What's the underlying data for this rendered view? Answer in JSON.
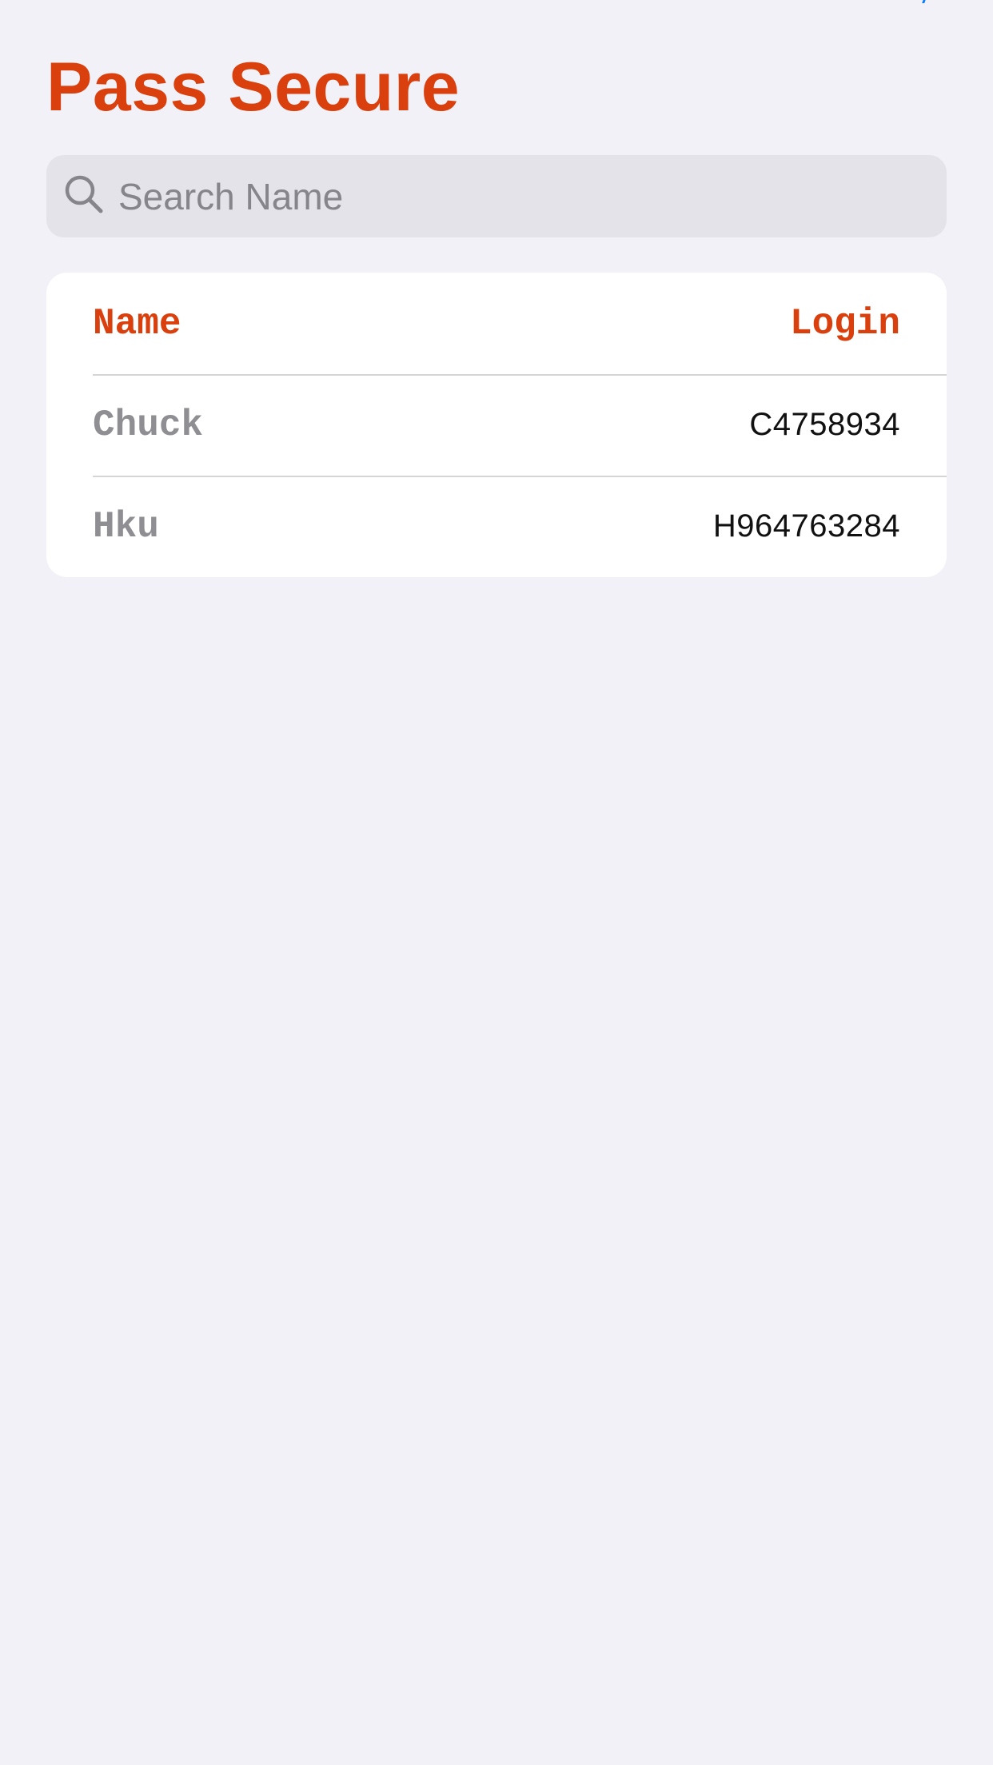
{
  "app": {
    "title": "Pass Secure",
    "accent_color": "#d9400e"
  },
  "search": {
    "icon": "search-icon",
    "value": "",
    "placeholder": "Search Name"
  },
  "table": {
    "columns": {
      "name": "Name",
      "login": "Login"
    },
    "rows": [
      {
        "name": "Chuck",
        "login": "C4758934"
      },
      {
        "name": "Hku",
        "login": "H964763284"
      }
    ]
  }
}
